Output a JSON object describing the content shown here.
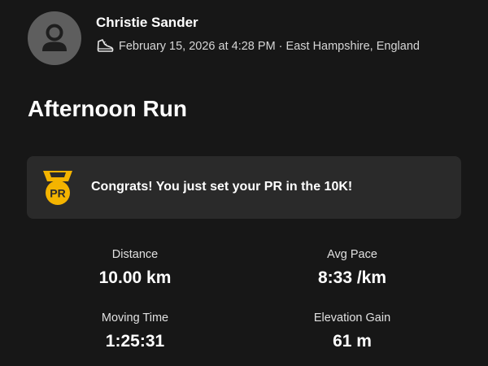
{
  "header": {
    "athlete_name": "Christie Sander",
    "meta_text": "February 15, 2026 at 4:28 PM · East Hampshire, England",
    "activity_icon": "running-shoe-icon",
    "avatar_icon": "user-silhouette-icon"
  },
  "activity": {
    "title": "Afternoon Run"
  },
  "achievement": {
    "badge_label": "PR",
    "message": "Congrats! You just set your PR in the 10K!",
    "badge_color": "#f4b400"
  },
  "stats": {
    "distance": {
      "label": "Distance",
      "value": "10.00 km"
    },
    "avg_pace": {
      "label": "Avg Pace",
      "value": "8:33 /km"
    },
    "moving_time": {
      "label": "Moving Time",
      "value": "1:25:31"
    },
    "elevation_gain": {
      "label": "Elevation Gain",
      "value": "61 m"
    }
  },
  "colors": {
    "background": "#171717",
    "card": "#2a2a2a",
    "avatar": "#5e5e5e",
    "accent": "#f4b400"
  }
}
